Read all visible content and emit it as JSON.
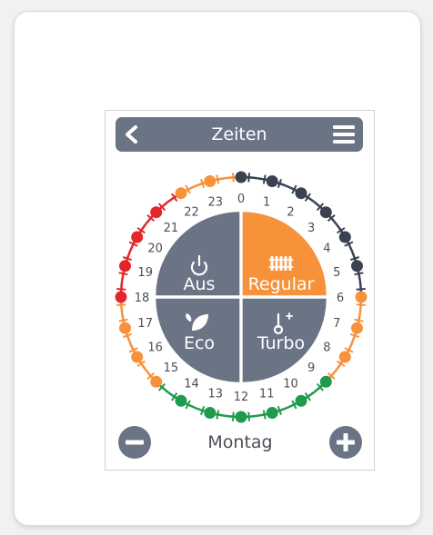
{
  "colors": {
    "slate": "#6b7485",
    "dark": "#3a4150",
    "orange": "#f7923a",
    "red": "#e3262c",
    "green": "#1f9a4e",
    "white": "#ffffff"
  },
  "header": {
    "title": "Zeiten",
    "back_icon": "chevron-left-icon",
    "menu_icon": "hamburger-menu-icon"
  },
  "modes": [
    {
      "key": "aus",
      "label": "Aus",
      "icon": "power-icon",
      "active": false
    },
    {
      "key": "regular",
      "label": "Regular",
      "icon": "radiator-icon",
      "active": true
    },
    {
      "key": "eco",
      "label": "Eco",
      "icon": "leaf-icon",
      "active": false
    },
    {
      "key": "turbo",
      "label": "Turbo",
      "icon": "thermometer-plus-icon",
      "active": false
    }
  ],
  "hours": [
    "0",
    "1",
    "2",
    "3",
    "4",
    "5",
    "6",
    "7",
    "8",
    "9",
    "10",
    "11",
    "12",
    "13",
    "14",
    "15",
    "16",
    "17",
    "18",
    "19",
    "20",
    "21",
    "22",
    "23"
  ],
  "schedule": [
    {
      "from": 0,
      "to": 6,
      "mode": "dark"
    },
    {
      "from": 6,
      "to": 9,
      "mode": "orange"
    },
    {
      "from": 9,
      "to": 15,
      "mode": "green"
    },
    {
      "from": 15,
      "to": 18,
      "mode": "orange"
    },
    {
      "from": 18,
      "to": 22,
      "mode": "red"
    },
    {
      "from": 22,
      "to": 24,
      "mode": "orange"
    }
  ],
  "footer": {
    "day": "Montag",
    "prev_icon": "minus-icon",
    "next_icon": "plus-icon"
  }
}
